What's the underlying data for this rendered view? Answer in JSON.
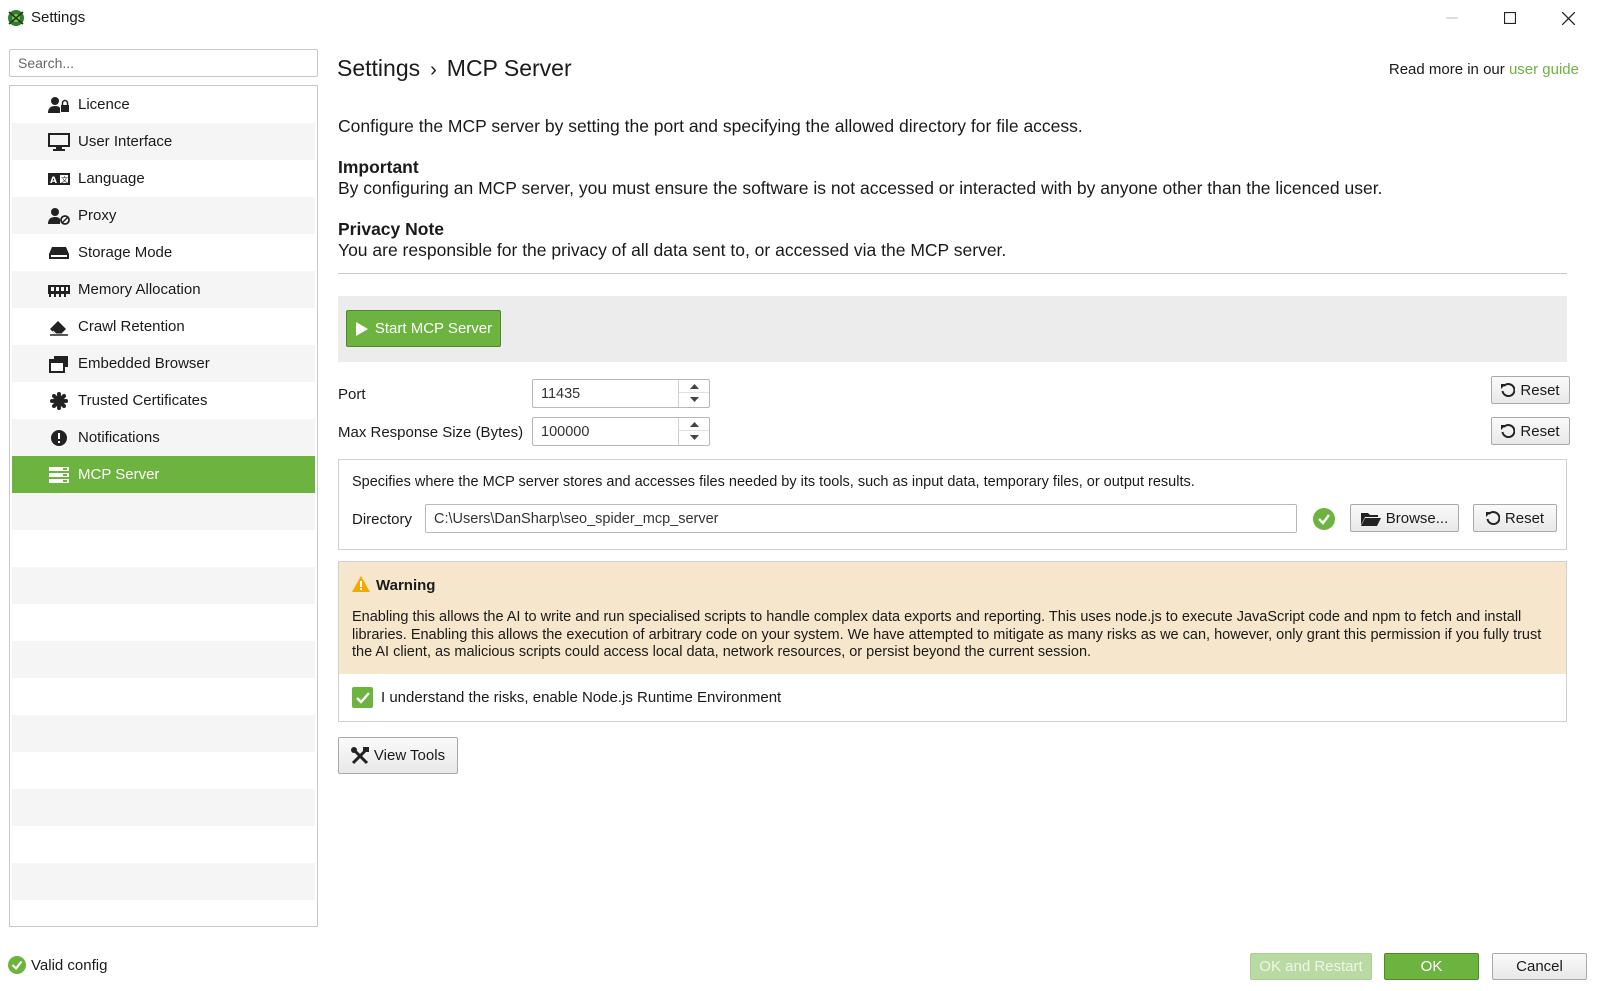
{
  "window": {
    "title": "Settings",
    "icon": "spider-logo-icon",
    "controls": [
      "minimize-icon",
      "maximize-icon",
      "close-icon"
    ]
  },
  "sidebar": {
    "search_placeholder": "Search...",
    "items": [
      {
        "label": "Licence",
        "icon": "user-lock-icon"
      },
      {
        "label": "User Interface",
        "icon": "monitor-icon"
      },
      {
        "label": "Language",
        "icon": "language-icon"
      },
      {
        "label": "Proxy",
        "icon": "user-proxy-icon"
      },
      {
        "label": "Storage Mode",
        "icon": "hard-drive-icon"
      },
      {
        "label": "Memory Allocation",
        "icon": "memory-icon"
      },
      {
        "label": "Crawl Retention",
        "icon": "eraser-icon"
      },
      {
        "label": "Embedded Browser",
        "icon": "browser-windows-icon"
      },
      {
        "label": "Trusted Certificates",
        "icon": "certificate-icon"
      },
      {
        "label": "Notifications",
        "icon": "exclamation-icon"
      },
      {
        "label": "MCP Server",
        "icon": "server-icon",
        "selected": true
      }
    ]
  },
  "main": {
    "breadcrumb_root": "Settings",
    "breadcrumb_sep": "›",
    "breadcrumb_current": "MCP Server",
    "read_more_prefix": "Read more in our",
    "read_more_link": "user guide",
    "intro": "Configure the MCP server by setting the port and specifying the allowed directory for file access.",
    "important_title": "Important",
    "important_text": "By configuring an MCP server, you must ensure the software is not accessed or interacted with by anyone other than the licenced user.",
    "privacy_title": "Privacy Note",
    "privacy_text": "You are responsible for the privacy of all data sent to, or accessed via the MCP server.",
    "start_button": "Start MCP Server",
    "port_label": "Port",
    "port_value": "11435",
    "max_response_label": "Max Response Size (Bytes)",
    "max_response_value": "100000",
    "reset_label": "Reset",
    "directory_description": "Specifies where the MCP server stores and accesses files needed by its tools, such as input data, temporary files, or output results.",
    "directory_label": "Directory",
    "directory_value": "C:\\Users\\DanSharp\\seo_spider_mcp_server",
    "browse_label": "Browse...",
    "warning_title": "Warning",
    "warning_text": "Enabling this allows the AI to write and run specialised scripts to handle complex data exports and reporting. This uses node.js to execute JavaScript code and npm to fetch and install libraries. Enabling this allows the execution of arbitrary code on your system. We have attempted to mitigate as many risks as we can, however, only grant this permission if you fully trust the AI client, as malicious scripts could access local data, network resources, or persist beyond the current session.",
    "nodejs_checkbox_label": "I understand the risks, enable Node.js Runtime Environment",
    "nodejs_checked": true,
    "view_tools_label": "View Tools"
  },
  "footer": {
    "status": "Valid config",
    "ok_restart": "OK and Restart",
    "ok": "OK",
    "cancel": "Cancel"
  },
  "colors": {
    "accent": "#6db33f",
    "warning_bg": "#f5e6cc"
  }
}
